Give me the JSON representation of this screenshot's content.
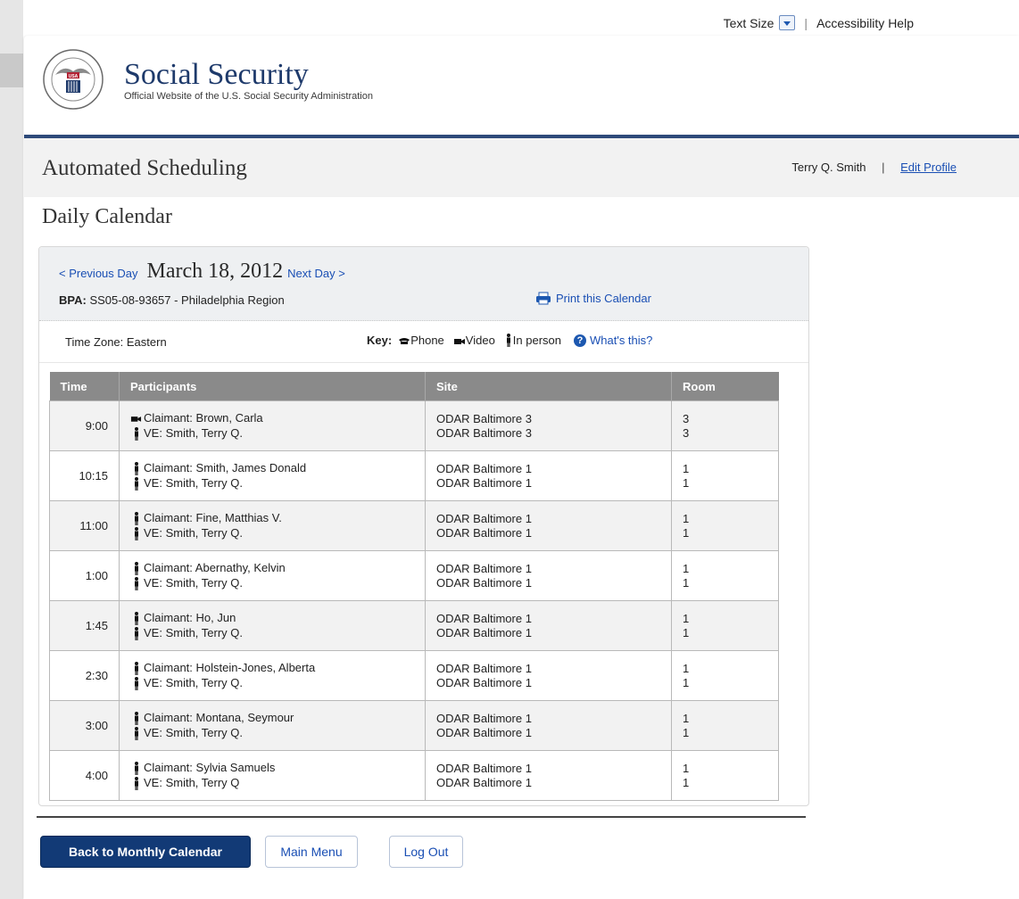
{
  "utility": {
    "text_size_label": "Text Size",
    "accessibility_label": "Accessibility Help"
  },
  "brand": {
    "title": "Social Security",
    "subtitle": "Official Website of the U.S. Social Security Administration",
    "seal_text": "SOCIAL SECURITY USA ADMINISTRATION"
  },
  "app": {
    "title": "Automated Scheduling",
    "user_name": "Terry Q. Smith",
    "separator": "|",
    "edit_profile": "Edit Profile"
  },
  "page_title": "Daily Calendar",
  "calendar": {
    "prev_day": "< Previous Day",
    "date": "March 18, 2012",
    "next_day": "Next Day >",
    "bpa_label": "BPA:",
    "bpa_value": "SS05-08-93657 - Philadelphia Region",
    "print_label": "Print this Calendar",
    "time_zone": "Time Zone: Eastern",
    "key_label": "Key:",
    "key_phone": "Phone",
    "key_video": "Video",
    "key_in_person": "In person",
    "whats_this": "What's this?"
  },
  "table": {
    "headers": [
      "Time",
      "Participants",
      "Site",
      "Room"
    ],
    "rows": [
      {
        "time": "9:00",
        "participants": [
          {
            "mode": "video",
            "text": "Claimant: Brown, Carla"
          },
          {
            "mode": "in-person",
            "text": "VE: Smith, Terry Q."
          }
        ],
        "sites": [
          "ODAR Baltimore 3",
          "ODAR Baltimore 3"
        ],
        "rooms": [
          "3",
          "3"
        ]
      },
      {
        "time": "10:15",
        "participants": [
          {
            "mode": "in-person",
            "text": "Claimant: Smith, James Donald"
          },
          {
            "mode": "in-person",
            "text": "VE: Smith, Terry Q."
          }
        ],
        "sites": [
          "ODAR Baltimore 1",
          "ODAR Baltimore 1"
        ],
        "rooms": [
          "1",
          "1"
        ]
      },
      {
        "time": "11:00",
        "participants": [
          {
            "mode": "in-person",
            "text": "Claimant: Fine, Matthias V."
          },
          {
            "mode": "in-person",
            "text": "VE: Smith, Terry Q."
          }
        ],
        "sites": [
          "ODAR Baltimore 1",
          "ODAR Baltimore 1"
        ],
        "rooms": [
          "1",
          "1"
        ]
      },
      {
        "time": "1:00",
        "participants": [
          {
            "mode": "in-person",
            "text": "Claimant: Abernathy, Kelvin"
          },
          {
            "mode": "in-person",
            "text": "VE: Smith, Terry Q."
          }
        ],
        "sites": [
          "ODAR Baltimore 1",
          "ODAR Baltimore 1"
        ],
        "rooms": [
          "1",
          "1"
        ]
      },
      {
        "time": "1:45",
        "participants": [
          {
            "mode": "in-person",
            "text": "Claimant: Ho, Jun"
          },
          {
            "mode": "in-person",
            "text": "VE: Smith, Terry Q."
          }
        ],
        "sites": [
          "ODAR Baltimore 1",
          "ODAR Baltimore 1"
        ],
        "rooms": [
          "1",
          "1"
        ]
      },
      {
        "time": "2:30",
        "participants": [
          {
            "mode": "in-person",
            "text": "Claimant: Holstein-Jones, Alberta"
          },
          {
            "mode": "in-person",
            "text": "VE: Smith, Terry Q."
          }
        ],
        "sites": [
          "ODAR Baltimore 1",
          "ODAR Baltimore 1"
        ],
        "rooms": [
          "1",
          "1"
        ]
      },
      {
        "time": "3:00",
        "participants": [
          {
            "mode": "in-person",
            "text": "Claimant: Montana, Seymour"
          },
          {
            "mode": "in-person",
            "text": "VE: Smith, Terry Q."
          }
        ],
        "sites": [
          "ODAR Baltimore 1",
          "ODAR Baltimore 1"
        ],
        "rooms": [
          "1",
          "1"
        ]
      },
      {
        "time": "4:00",
        "participants": [
          {
            "mode": "in-person",
            "text": "Claimant: Sylvia Samuels"
          },
          {
            "mode": "in-person",
            "text": "VE: Smith, Terry Q"
          }
        ],
        "sites": [
          "ODAR Baltimore 1",
          "ODAR Baltimore 1"
        ],
        "rooms": [
          "1",
          "1"
        ]
      }
    ]
  },
  "buttons": {
    "back": "Back to Monthly Calendar",
    "main_menu": "Main Menu",
    "log_out": "Log Out"
  },
  "colors": {
    "brand_navy": "#1e3a6b",
    "rule": "#2e4a7a",
    "primary_button": "#123a76",
    "link": "#1a4fb4",
    "table_header": "#8a8a8a"
  }
}
